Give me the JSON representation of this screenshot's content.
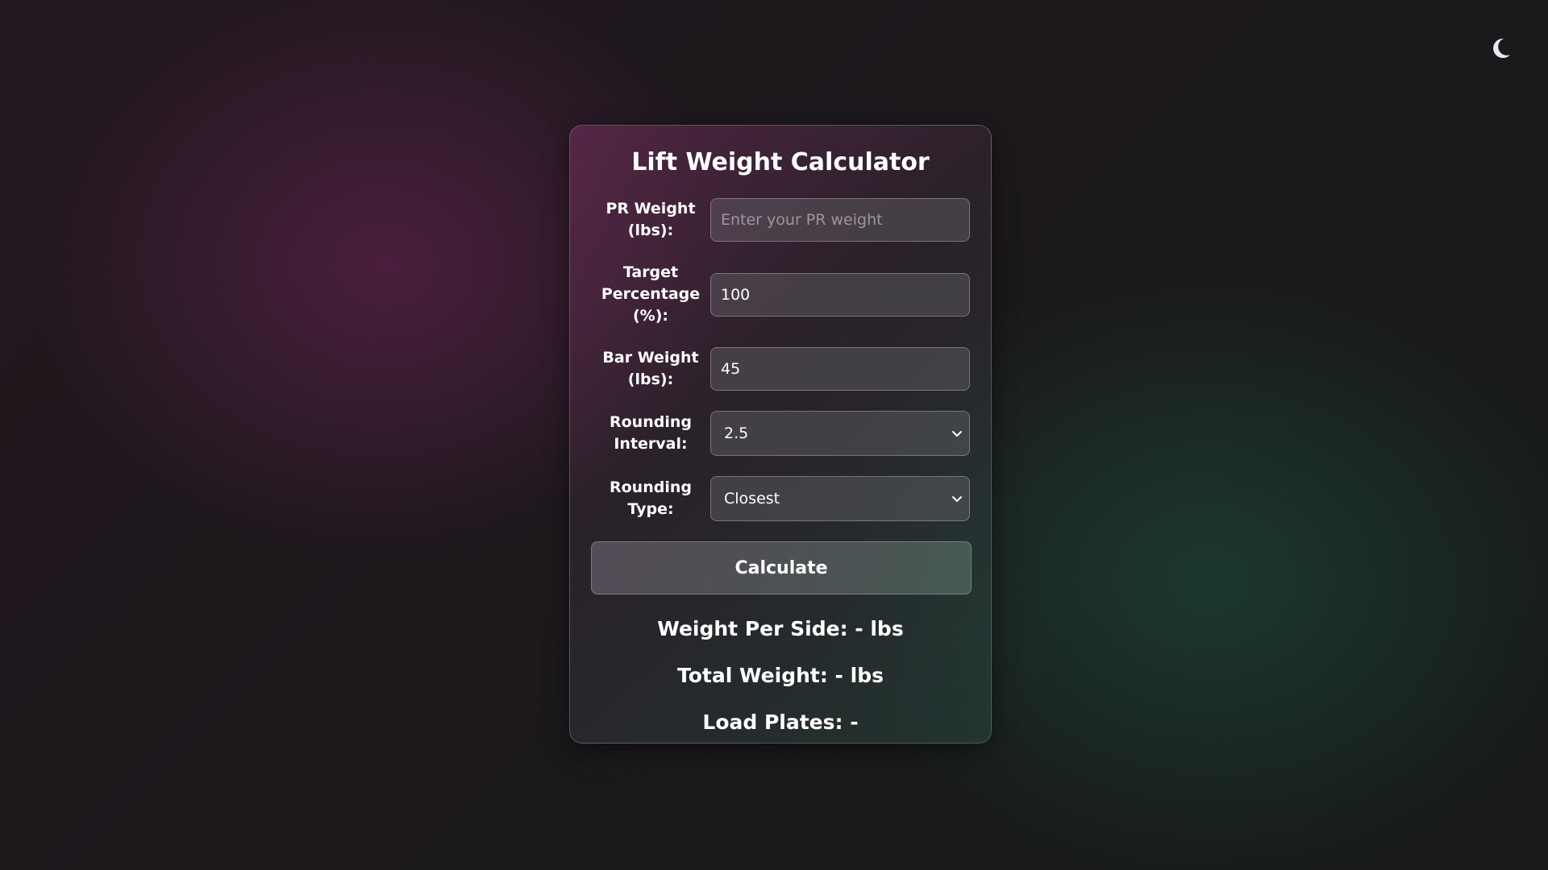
{
  "theme_toggle": {
    "icon": "moon-icon"
  },
  "calculator": {
    "title": "Lift Weight Calculator",
    "fields": {
      "pr_weight": {
        "label": "PR Weight (lbs):",
        "value": "",
        "placeholder": "Enter your PR weight"
      },
      "target_percentage": {
        "label": "Target Percentage (%):",
        "value": "100"
      },
      "bar_weight": {
        "label": "Bar Weight (lbs):",
        "value": "45"
      },
      "rounding_interval": {
        "label": "Rounding Interval:",
        "selected": "2.5"
      },
      "rounding_type": {
        "label": "Rounding Type:",
        "selected": "Closest"
      }
    },
    "calculate_label": "Calculate",
    "results": {
      "weight_per_side": "Weight Per Side: - lbs",
      "total_weight": "Total Weight: - lbs",
      "load_plates": "Load Plates: -"
    }
  },
  "colors": {
    "text": "#ffffff",
    "accent_left": "#6e2456",
    "accent_right": "#1e6448"
  }
}
